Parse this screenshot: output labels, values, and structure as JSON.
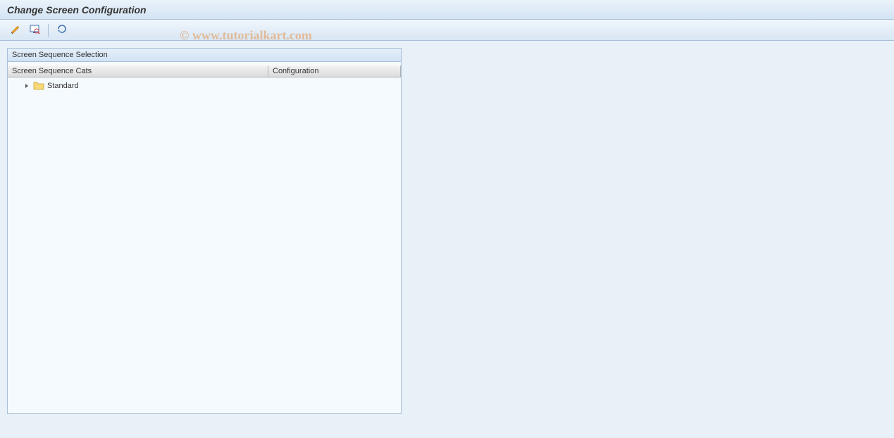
{
  "header": {
    "title": "Change Screen Configuration"
  },
  "toolbar": {
    "icon1": "pencil-glasses-icon",
    "icon2": "display-change-icon",
    "icon3": "other-object-icon"
  },
  "panel": {
    "title": "Screen Sequence Selection",
    "columns": {
      "cats": "Screen Sequence Cats",
      "config": "Configuration"
    },
    "tree": {
      "items": [
        {
          "label": "Standard",
          "expanded": false
        }
      ]
    }
  },
  "watermark": "© www.tutorialkart.com"
}
